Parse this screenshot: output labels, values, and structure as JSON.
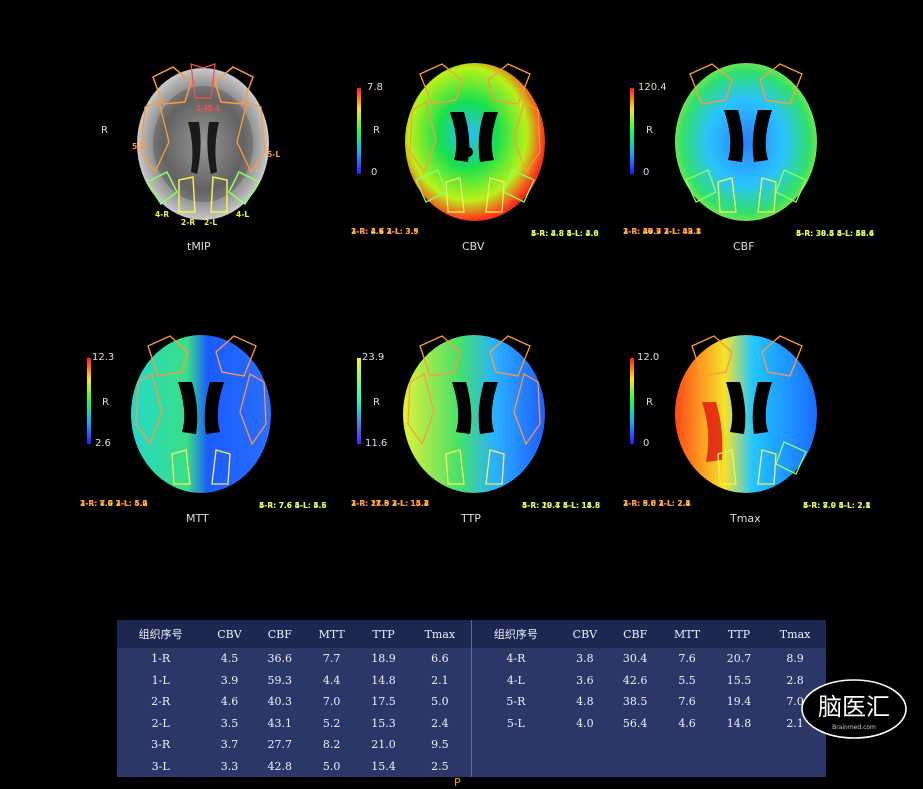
{
  "panels": [
    {
      "id": "tmip",
      "name": "tMIP",
      "side": "R",
      "scale": null
    },
    {
      "id": "cbv",
      "name": "CBV",
      "side": "R",
      "scale": {
        "max": "7.8",
        "min": "0"
      },
      "left": [
        "1-R:  4.5 1-L:  3.9",
        "2-R:  4.6 2-L:  3.5",
        "3-R:  3.7 3-L:  3.3"
      ],
      "right": [
        "4-R:  3.8 4-L:  3.6",
        "5-R:  4.8 5-L:  4.0"
      ]
    },
    {
      "id": "cbf",
      "name": "CBF",
      "side": "R",
      "scale": {
        "max": "120.4",
        "min": "0"
      },
      "left": [
        "1-R:  36.6 1-L:  59.3",
        "2-R:  40.3 2-L:  43.1",
        "3-R:  27.7 3-L:  42.8"
      ],
      "right": [
        "4-R:  30.4 4-L:  42.6",
        "5-R:  38.5 5-L:  56.4"
      ]
    },
    {
      "id": "mtt",
      "name": "MTT",
      "side": "R",
      "scale": {
        "max": "12.3",
        "min": "2.6"
      },
      "left": [
        "1-R:  7.7 1-L:  4.4",
        "2-R:  7.0 2-L:  5.2",
        "3-R:  8.2 3-L:  5.0"
      ],
      "right": [
        "4-R:  7.6 4-L:  5.5",
        "5-R:  7.6 5-L:  4.6"
      ]
    },
    {
      "id": "ttp",
      "name": "TTP",
      "side": "R",
      "scale": {
        "max": "23.9",
        "min": "11.6"
      },
      "left": [
        "1-R:  18.9 1-L:  14.8",
        "2-R:  17.5 2-L:  15.3",
        "3-R:  21.0 3-L:  15.4"
      ],
      "right": [
        "4-R:  20.7 4-L:  15.5",
        "5-R:  19.4 5-L:  14.8"
      ]
    },
    {
      "id": "tmax",
      "name": "Tmax",
      "side": "R",
      "scale": {
        "max": "12.0",
        "min": "0"
      },
      "left": [
        "1-R:  6.6 1-L:  2.1",
        "2-R:  5.0 2-L:  2.4",
        "3-R:  9.5 3-L:  2.5"
      ],
      "right": [
        "4-R:  8.9 4-L:  2.8",
        "5-R:  7.0 5-L:  2.1"
      ]
    }
  ],
  "roi_labels": [
    "1-R",
    "1-L",
    "2-R",
    "2-L",
    "3-R",
    "3-L",
    "4-R",
    "4-L",
    "5-R",
    "5-L"
  ],
  "table": {
    "headers": [
      "组织序号",
      "CBV",
      "CBF",
      "MTT",
      "TTP",
      "Tmax"
    ],
    "left_rows": [
      [
        "1-R",
        "4.5",
        "36.6",
        "7.7",
        "18.9",
        "6.6"
      ],
      [
        "1-L",
        "3.9",
        "59.3",
        "4.4",
        "14.8",
        "2.1"
      ],
      [
        "2-R",
        "4.6",
        "40.3",
        "7.0",
        "17.5",
        "5.0"
      ],
      [
        "2-L",
        "3.5",
        "43.1",
        "5.2",
        "15.3",
        "2.4"
      ],
      [
        "3-R",
        "3.7",
        "27.7",
        "8.2",
        "21.0",
        "9.5"
      ],
      [
        "3-L",
        "3.3",
        "42.8",
        "5.0",
        "15.4",
        "2.5"
      ]
    ],
    "right_rows": [
      [
        "4-R",
        "3.8",
        "30.4",
        "7.6",
        "20.7",
        "8.9"
      ],
      [
        "4-L",
        "3.6",
        "42.6",
        "5.5",
        "15.5",
        "2.8"
      ],
      [
        "5-R",
        "4.8",
        "38.5",
        "7.6",
        "19.4",
        "7.0"
      ],
      [
        "5-L",
        "4.0",
        "56.4",
        "4.6",
        "14.8",
        "2.1"
      ],
      [
        "",
        "",
        "",
        "",
        "",
        ""
      ],
      [
        "",
        "",
        "",
        "",
        "",
        ""
      ]
    ]
  },
  "logo": {
    "text": "脑医汇",
    "subtext": "Brainmed.com"
  },
  "footer_char": "P",
  "colors": {
    "roi_red": "#ff4b4b",
    "roi_yellow": "#f5f05a",
    "roi_orange": "#ff9a3c",
    "roi_green": "#8dff6a",
    "table_bg": "#2b3766"
  }
}
